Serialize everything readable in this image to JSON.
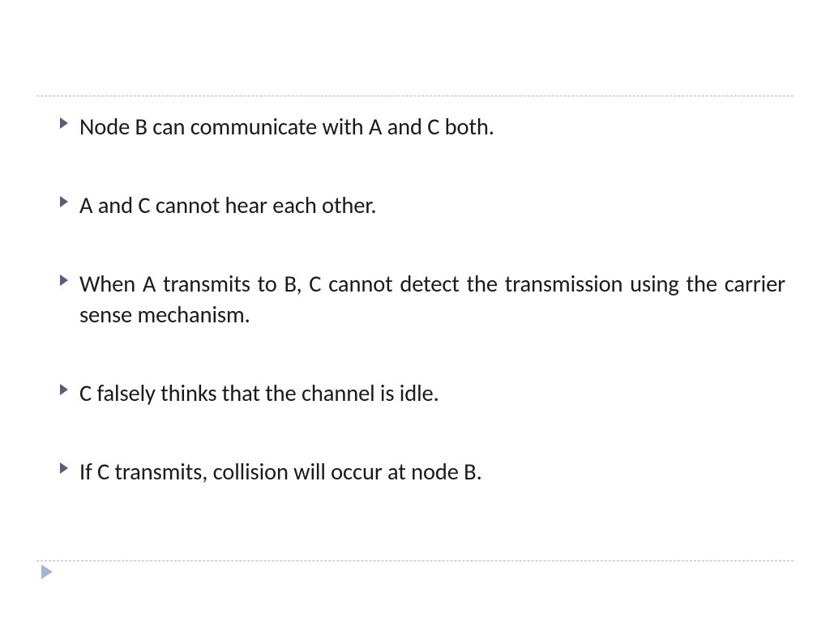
{
  "bullets": {
    "b1": "Node B can communicate with A and C both.",
    "b2": "A and C cannot hear each other.",
    "b3": "When A transmits to B, C cannot detect the transmission using the carrier sense mechanism.",
    "b4": "C falsely thinks that the channel is idle.",
    "b5": "If C transmits, collision will occur at node B."
  },
  "colors": {
    "bullet_marker": "#5a5a7a",
    "separator": "#b5b3c6",
    "footer_marker": "#a6b4d4"
  }
}
